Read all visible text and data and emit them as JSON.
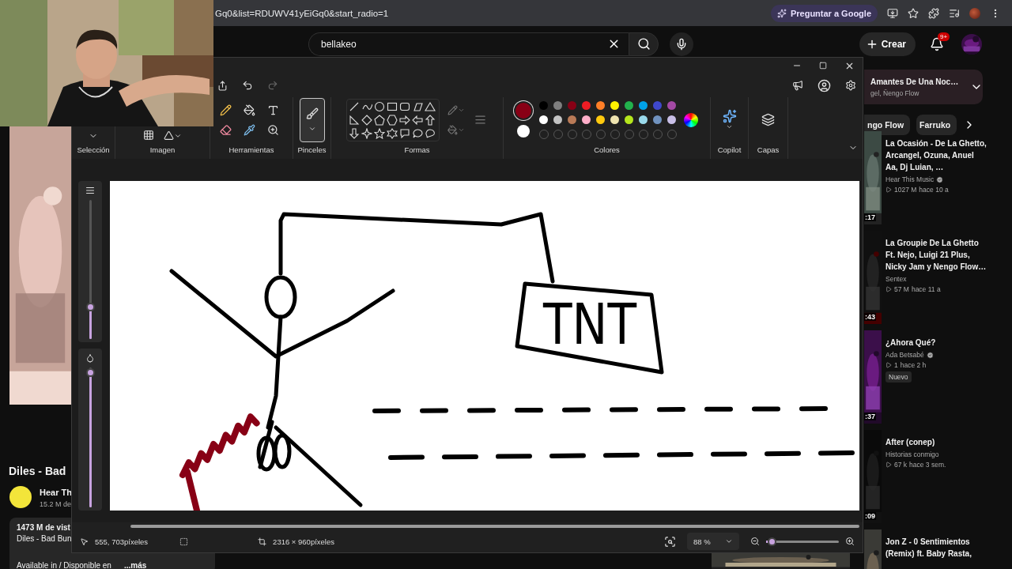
{
  "browser": {
    "url": "Gq0&list=RDUWV41yEiGq0&start_radio=1",
    "chip": "Preguntar a Google"
  },
  "youtube": {
    "search": {
      "value": "bellakeo"
    },
    "create": "Crear",
    "notifications": "9+"
  },
  "video": {
    "title": "Diles - Bad",
    "channel": "Hear Th",
    "subscribers": "15.2 M de",
    "views": "1473 M de vist",
    "description": "Diles - Bad Bun",
    "availability": "Available in / Disponible en",
    "more": "...más"
  },
  "playlist": {
    "title": "Amantes De Una Noc…",
    "artists": "gel, Ñengo Flow"
  },
  "chips": [
    {
      "label": "ngo Flow",
      "selected": false
    },
    {
      "label": "Farruko",
      "selected": false
    }
  ],
  "related": [
    {
      "title": "La Ocasión - De La Ghetto, Arcangel, Ozuna, Anuel Aa, Dj Luian, …",
      "channel": "Hear This Music",
      "verified": true,
      "views": "1027 M",
      "age": "hace 10 a",
      "duration": ":17"
    },
    {
      "title": "La Groupie De La Ghetto Ft. Nejo, Luigi 21 Plus, Nicky Jam y Nengo Flow…",
      "channel": "Sentex",
      "verified": false,
      "views": "57 M",
      "age": "hace 11 a",
      "duration": ":43"
    },
    {
      "title": "¿Ahora Qué?",
      "channel": "Ada Betsabé",
      "verified": true,
      "views": "1",
      "age": "hace 2 h",
      "badge": "Nuevo",
      "duration": ":37"
    },
    {
      "title": "After (conep)",
      "channel": "Historias conmigo",
      "verified": false,
      "views": "67 k",
      "age": "hace 3 sem.",
      "duration": ":09"
    },
    {
      "title": "Jon Z - 0 Sentimientos (Remix) ft. Baby Rasta,"
    }
  ],
  "paint": {
    "ribbon": [
      {
        "kind": "selection",
        "label": "Selección"
      },
      {
        "label": "Imagen"
      },
      {
        "kind": "tools",
        "label": "Herramientas"
      },
      {
        "kind": "brushes",
        "label": "Pinceles",
        "selected": true
      },
      {
        "kind": "shapes",
        "label": "Formas"
      },
      {
        "kind": "colors",
        "label": "Colores"
      },
      {
        "kind": "copilot",
        "label": "Copilot"
      },
      {
        "kind": "layers",
        "label": "Capas"
      }
    ],
    "current_colors": [
      {
        "color": "#880015",
        "selected": true
      },
      {
        "color": "#ffffff",
        "selected": false
      }
    ],
    "palette": [
      {
        "color": "#000000"
      },
      {
        "color": "#7f7f7f"
      },
      {
        "color": "#880015"
      },
      {
        "color": "#ed1c24"
      },
      {
        "color": "#ff7f27"
      },
      {
        "color": "#fff200"
      },
      {
        "color": "#22b14c"
      },
      {
        "color": "#00a2e8"
      },
      {
        "color": "#3f48cc"
      },
      {
        "color": "#a349a4"
      },
      {
        "color": "#ffffff"
      },
      {
        "color": "#c3c3c3"
      },
      {
        "color": "#b97a57"
      },
      {
        "color": "#ffaec9"
      },
      {
        "color": "#ffc90e"
      },
      {
        "color": "#efe4b0"
      },
      {
        "color": "#b5e61d"
      },
      {
        "color": "#99d9ea"
      },
      {
        "color": "#7092be"
      },
      {
        "color": "#c8bfe7"
      }
    ],
    "brush_size": {
      "level": 0.23
    },
    "opacity": {
      "level": 0.96
    },
    "canvas": {
      "text": "TNT"
    },
    "status": {
      "cursor": "555, 703píxeles",
      "size": "2316 × 960píxeles",
      "zoom": "88 %"
    },
    "zoom_slider": {
      "level": 0.08
    }
  }
}
